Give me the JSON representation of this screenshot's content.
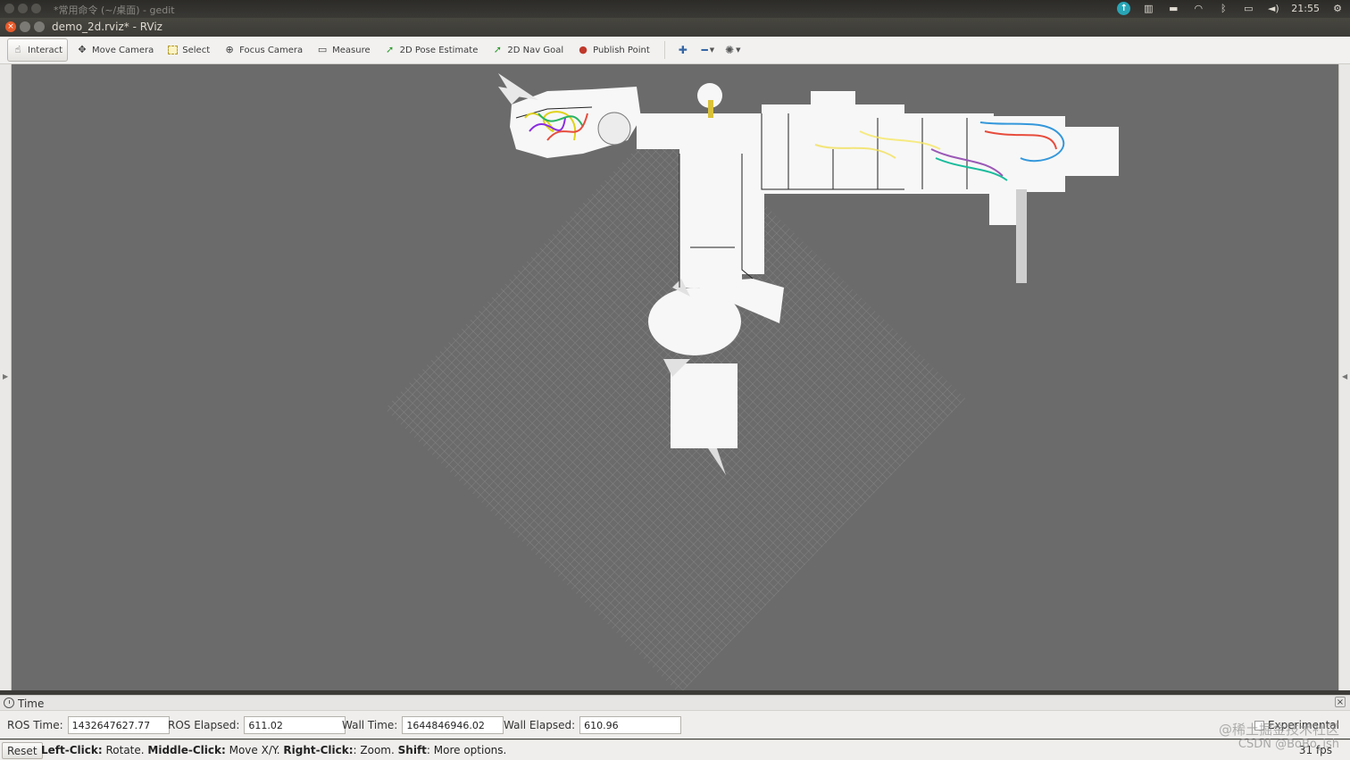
{
  "system": {
    "background_window_title": "*常用命令 (~/桌面) - gedit",
    "clock": "21:55",
    "tray_icons": [
      "update-icon",
      "keyboard-layout-icon",
      "input-method-icon",
      "wifi-icon",
      "bluetooth-icon",
      "battery-icon",
      "volume-icon",
      "settings-icon"
    ]
  },
  "window": {
    "title": "demo_2d.rviz* - RViz"
  },
  "toolbar": {
    "tools": [
      {
        "label": "Interact",
        "icon": "hand-icon",
        "active": true
      },
      {
        "label": "Move Camera",
        "icon": "move-camera-icon",
        "active": false
      },
      {
        "label": "Select",
        "icon": "select-icon",
        "active": false
      },
      {
        "label": "Focus Camera",
        "icon": "focus-camera-icon",
        "active": false
      },
      {
        "label": "Measure",
        "icon": "ruler-icon",
        "active": false
      },
      {
        "label": "2D Pose Estimate",
        "icon": "green-arrow-icon",
        "active": false
      },
      {
        "label": "2D Nav Goal",
        "icon": "green-arrow-icon",
        "active": false
      },
      {
        "label": "Publish Point",
        "icon": "pin-icon",
        "active": false
      }
    ],
    "extra_icons": [
      "add-tool-icon",
      "remove-tool-icon",
      "tool-properties-icon"
    ]
  },
  "time_panel": {
    "title": "Time",
    "ros_time_label": "ROS Time:",
    "ros_time": "1432647627.77",
    "ros_elapsed_label": "ROS Elapsed:",
    "ros_elapsed": "611.02",
    "wall_time_label": "Wall Time:",
    "wall_time": "1644846946.02",
    "wall_elapsed_label": "Wall Elapsed:",
    "wall_elapsed": "610.96",
    "experimental_label": "Experimental"
  },
  "status": {
    "reset_label": "Reset",
    "hint_parts": [
      {
        "b": "Left-Click:",
        "t": " Rotate. "
      },
      {
        "b": "Middle-Click:",
        "t": " Move X/Y. "
      },
      {
        "b": "Right-Click:",
        "t": ": Zoom. "
      },
      {
        "b": "Shift",
        "t": ": More options."
      }
    ],
    "fps": "31 fps"
  },
  "watermark": {
    "line1": "@稀土掘金技术社区",
    "line2": "CSDN @BoBo_ish"
  }
}
